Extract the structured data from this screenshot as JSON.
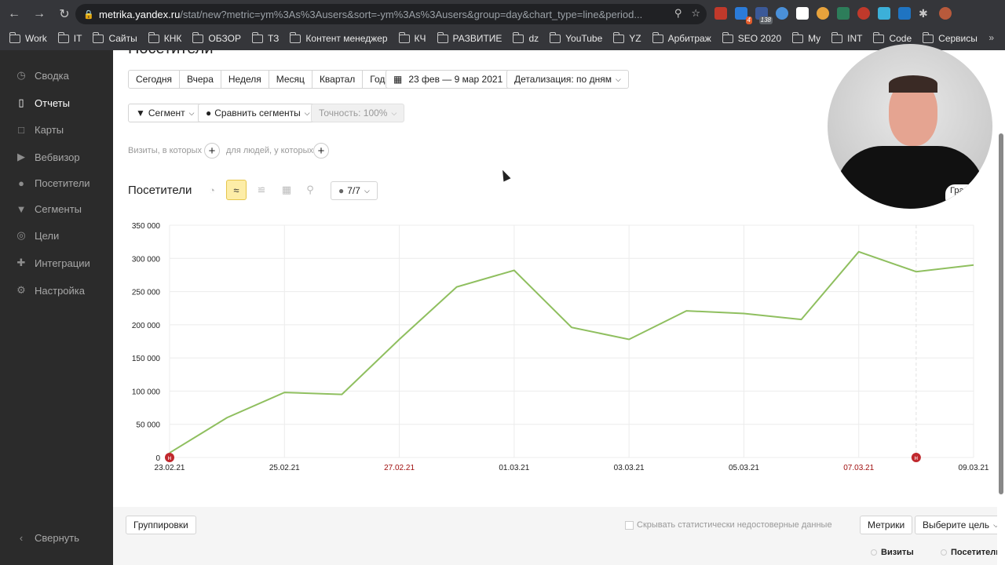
{
  "browser": {
    "url_host": "metrika.yandex.ru",
    "url_path": "/stat/new?metric=ym%3As%3Ausers&sort=-ym%3As%3Ausers&group=day&chart_type=line&period...",
    "ext_badge_1": "4",
    "ext_badge_2": "138",
    "bookmarks": [
      "Work",
      "IT",
      "Сайты",
      "КНК",
      "ОБЗОР",
      "ТЗ",
      "Контент менеджер",
      "КЧ",
      "РАЗВИТИЕ",
      "dz",
      "YouTube",
      "YZ",
      "Арбитраж",
      "SEO 2020",
      "My",
      "INT",
      "Code",
      "Сервисы"
    ],
    "more": "»"
  },
  "sidebar": {
    "items": [
      {
        "label": "Сводка",
        "icon": "clock-icon"
      },
      {
        "label": "Отчеты",
        "icon": "bar-chart-icon"
      },
      {
        "label": "Карты",
        "icon": "map-icon"
      },
      {
        "label": "Вебвизор",
        "icon": "play-icon"
      },
      {
        "label": "Посетители",
        "icon": "person-icon"
      },
      {
        "label": "Сегменты",
        "icon": "funnel-icon"
      },
      {
        "label": "Цели",
        "icon": "target-icon"
      },
      {
        "label": "Интеграции",
        "icon": "puzzle-icon"
      },
      {
        "label": "Настройка",
        "icon": "gear-icon"
      }
    ],
    "collapse_label": "Свернуть"
  },
  "main": {
    "page_title": "Посетители",
    "periods": [
      "Сегодня",
      "Вчера",
      "Неделя",
      "Месяц",
      "Квартал",
      "Год"
    ],
    "date_range": "23 фев — 9 мар 2021",
    "detail": "Детализация: по дням",
    "segment": "Сегмент",
    "compare": "Сравнить сегменты",
    "accuracy": "Точность: 100%",
    "filter_visits": "Визиты, в которых",
    "filter_people": "для людей, у которых",
    "report_title": "Посетители",
    "series_count": "7/7",
    "chart_toggle": "График",
    "group_button": "Группировки",
    "hide_unreliable": "Скрывать статистически недостоверные данные",
    "metrics_button": "Метрики",
    "goal_button": "Выберите цель",
    "col_visits": "Визиты",
    "col_visitors": "Посетители"
  },
  "chart_data": {
    "type": "line",
    "x": [
      "23.02.21",
      "24.02.21",
      "25.02.21",
      "26.02.21",
      "27.02.21",
      "28.02.21",
      "01.03.21",
      "02.03.21",
      "03.03.21",
      "04.03.21",
      "05.03.21",
      "06.03.21",
      "07.03.21",
      "08.03.21",
      "09.03.21"
    ],
    "x_tick_labels": [
      "23.02.21",
      "25.02.21",
      "27.02.21",
      "01.03.21",
      "03.03.21",
      "05.03.21",
      "07.03.21",
      "09.03.21"
    ],
    "weekend_ticks": [
      "27.02.21",
      "07.03.21"
    ],
    "y_tick_labels": [
      "0",
      "50 000",
      "100 000",
      "150 000",
      "200 000",
      "250 000",
      "300 000",
      "350 000"
    ],
    "ylim": [
      0,
      350000
    ],
    "series": [
      {
        "values": [
          7000,
          60000,
          98000,
          95000,
          178000,
          257000,
          282000,
          196000,
          178000,
          221000,
          217000,
          208000,
          310000,
          280000,
          290000
        ]
      }
    ],
    "holiday_markers": [
      {
        "x": "23.02.21",
        "label": "н"
      },
      {
        "x": "08.03.21",
        "label": "н"
      }
    ],
    "colors": {
      "line": "#8fbf5f",
      "weekend": "#a01010",
      "marker": "#c0282d"
    },
    "grid": true
  }
}
